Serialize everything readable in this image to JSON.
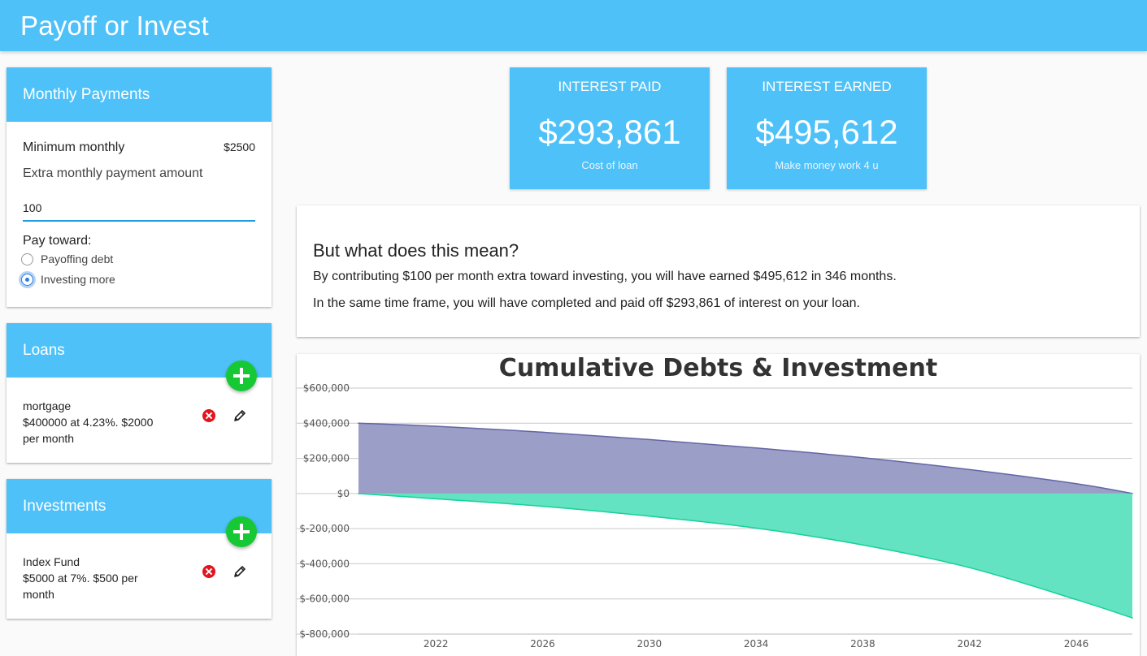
{
  "app": {
    "title": "Payoff or Invest"
  },
  "monthly_payments": {
    "heading": "Monthly Payments",
    "minimum_label": "Minimum monthly",
    "minimum_value": "$2500",
    "extra_label": "Extra monthly payment amount",
    "extra_value": "100",
    "pay_toward_label": "Pay toward:",
    "options": [
      {
        "label": "Payoffing debt",
        "selected": false
      },
      {
        "label": "Investing more",
        "selected": true
      }
    ]
  },
  "loans": {
    "heading": "Loans",
    "items": [
      {
        "name": "mortgage",
        "line1": "$400000 at 4.23%. $2000",
        "line2": "per month"
      }
    ]
  },
  "investments": {
    "heading": "Investments",
    "items": [
      {
        "name": "Index Fund",
        "line1": "$5000 at 7%. $500 per",
        "line2": "month"
      }
    ]
  },
  "stats": [
    {
      "title": "INTEREST PAID",
      "value": "$293,861",
      "subtitle": "Cost of loan"
    },
    {
      "title": "INTEREST EARNED",
      "value": "$495,612",
      "subtitle": "Make money work 4 u"
    }
  ],
  "meaning": {
    "heading": "But what does this mean?",
    "line1": "By contributing $100 per month extra toward investing, you will have earned $495,612 in 346 months.",
    "line2": "In the same time frame, you will have completed and paid off $293,861 of interest on your loan."
  },
  "colors": {
    "header": "#4fc1f9",
    "debt_fill": "#9b9ec6",
    "debt_line": "#6266a6",
    "invest_fill": "#63e3c1",
    "invest_line": "#16d19a",
    "add": "#16c934",
    "delete": "#e3141e"
  },
  "chart_data": {
    "type": "area",
    "title": "Cumulative Debts & Investment",
    "xlabel": "",
    "ylabel": "",
    "x_range": [
      2019.1,
      2048.1
    ],
    "ylim": [
      -800000,
      600000
    ],
    "y_ticks": [
      600000,
      400000,
      200000,
      0,
      -200000,
      -400000,
      -600000,
      -800000
    ],
    "y_tick_labels": [
      "$600,000",
      "$400,000",
      "$200,000",
      "$0",
      "$-200,000",
      "$-400,000",
      "$-600,000",
      "$-800,000"
    ],
    "x_ticks": [
      2022,
      2026,
      2030,
      2034,
      2038,
      2042,
      2046
    ],
    "x_tick_labels": [
      "2022",
      "2026",
      "2030",
      "2034",
      "2038",
      "2042",
      "2046"
    ],
    "grid": true,
    "legend": "none",
    "series": [
      {
        "x": [
          2019.1,
          2022,
          2026,
          2030,
          2034,
          2038,
          2042,
          2046,
          2048.1
        ],
        "values": [
          400000,
          383000,
          349000,
          307000,
          259000,
          204000,
          136000,
          56000,
          0
        ]
      },
      {
        "x": [
          2019.1,
          2022,
          2026,
          2030,
          2034,
          2038,
          2042,
          2046,
          2048.1
        ],
        "values": [
          0,
          -30000,
          -73000,
          -129000,
          -197000,
          -293000,
          -422000,
          -604000,
          -708000
        ]
      }
    ]
  }
}
